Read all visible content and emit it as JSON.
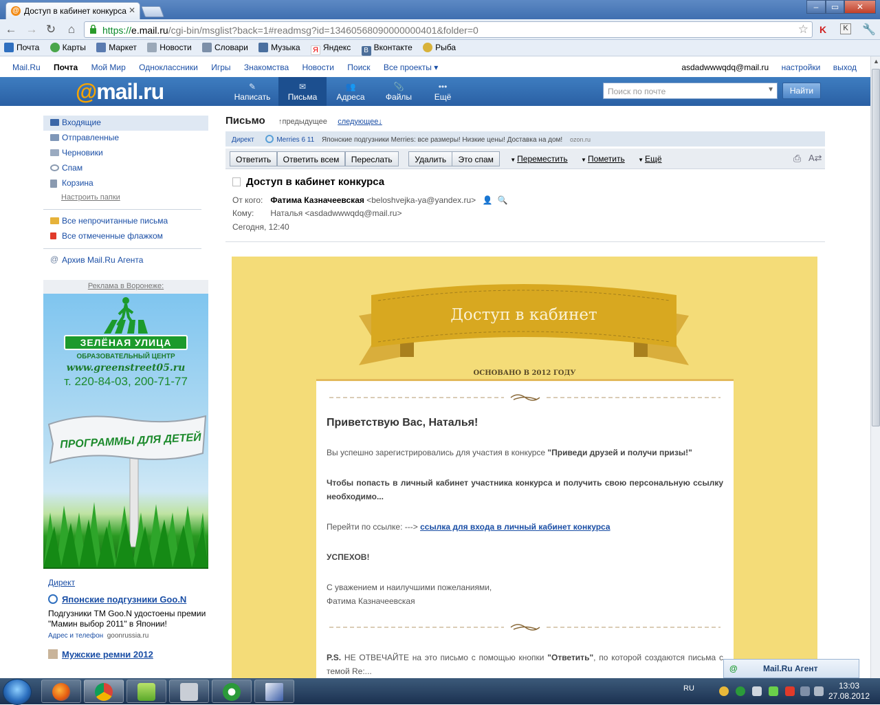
{
  "browser": {
    "tab_title": "Доступ в кабинет конкурса",
    "url_https": "https://",
    "url_host": "e.mail.ru",
    "url_path": "/cgi-bin/msglist?back=1#readmsg?id=13460568090000000401&folder=0",
    "bookmarks": [
      "Почта",
      "Карты",
      "Маркет",
      "Новости",
      "Словари",
      "Музыка",
      "Яндекс",
      "Вконтакте",
      "Рыба"
    ]
  },
  "portal": {
    "links": [
      "Mail.Ru",
      "Почта",
      "Мой Мир",
      "Одноклассники",
      "Игры",
      "Знакомства",
      "Новости",
      "Поиск",
      "Все проекты ▾"
    ],
    "user": "asdadwwwqdq@mail.ru",
    "settings": "настройки",
    "logout": "выход"
  },
  "mailbar": {
    "logo_at": "@",
    "logo_text": "mail.ru",
    "tools": [
      {
        "label": "Написать",
        "icon": "pencil-icon"
      },
      {
        "label": "Письма",
        "icon": "envelope-icon"
      },
      {
        "label": "Адреса",
        "icon": "contacts-icon"
      },
      {
        "label": "Файлы",
        "icon": "paperclip-icon"
      },
      {
        "label": "Ещё",
        "icon": "more-dots-icon"
      }
    ],
    "search_placeholder": "Поиск по почте",
    "search_button": "Найти"
  },
  "sidebar": {
    "folders": [
      "Входящие",
      "Отправленные",
      "Черновики",
      "Спам",
      "Корзина"
    ],
    "setup": "Настроить папки",
    "filters": [
      "Все непрочитанные письма",
      "Все отмеченные флажком"
    ],
    "agent_archive": "Архив Mail.Ru Агента",
    "ad_caption": "Реклама в Воронеже:",
    "ad_banner": {
      "title": "ЗЕЛЁНАЯ УЛИЦА",
      "subtitle": "ОБРАЗОВАТЕЛЬНЫЙ ЦЕНТР",
      "site": "www.greenstreet05.ru",
      "phone": "т. 220-84-03, 200-71-77",
      "sign": "ПРОГРАММЫ ДЛЯ ДЕТЕЙ"
    },
    "direct": {
      "label": "Директ",
      "ad1_title": "Японские подгузники Goo.N",
      "ad1_text": "Подгузники ТМ Goo.N удостоены премии \"Мамин выбор 2011\" в Японии!",
      "ad1_addr": "Адрес и телефон",
      "ad1_domain": "goonrussia.ru",
      "ad2_title": "Мужские ремни 2012"
    }
  },
  "letter": {
    "heading": "Письмо",
    "prev": "↑предыдущее",
    "next": "следующее↓",
    "adline": {
      "label": "Директ",
      "title": "Merries 6 11",
      "text": "Японские подгузники Merries: все размеры! Низкие цены! Доставка на дом!",
      "domain": "ozon.ru"
    },
    "buttons": [
      "Ответить",
      "Ответить всем",
      "Переслать",
      "Удалить",
      "Это спам"
    ],
    "menus": [
      "Переместить",
      "Пометить",
      "Ещё"
    ],
    "subject": "Доступ в кабинет конкурса",
    "from_label": "От кого:",
    "from_name": "Фатима Казначеевская",
    "from_email": "<beloshvejka-ya@yandex.ru>",
    "to_label": "Кому:",
    "to_value": "Наталья <asdadwwwqdq@mail.ru>",
    "date": "Сегодня, 12:40"
  },
  "body": {
    "banner": "Доступ в кабинет",
    "founded": "ОСНОВАНО В 2012 ГОДУ",
    "greeting": "Приветствую Вас, Наталья!",
    "p1": "Вы успешно зарегистрировались для участия в конкурсе ",
    "p1_bold": "\"Приведи друзей и получи призы!\"",
    "p2": "Чтобы попасть в личный кабинет участника конкурса и получить свою персональную ссылку необходимо...",
    "p3": "Перейти по ссылке: --->",
    "p3_link": "ссылка для входа в личный кабинет конкурса",
    "p4": "УСПЕХОВ!",
    "p5a": "С уважением и наилучшими пожеланиями,",
    "p5b": "Фатима Казначеевская",
    "ps_label": "P.S.",
    "ps_text1": " НЕ ОТВЕЧАЙТЕ на это письмо с помощью кнопки ",
    "ps_bold": "\"Ответить\"",
    "ps_text2": ",  по которой создаются письма с темой Re:..."
  },
  "agent": {
    "label": "Mail.Ru Агент"
  },
  "taskbar": {
    "lang": "RU",
    "time": "13:03",
    "date": "27.08.2012"
  }
}
